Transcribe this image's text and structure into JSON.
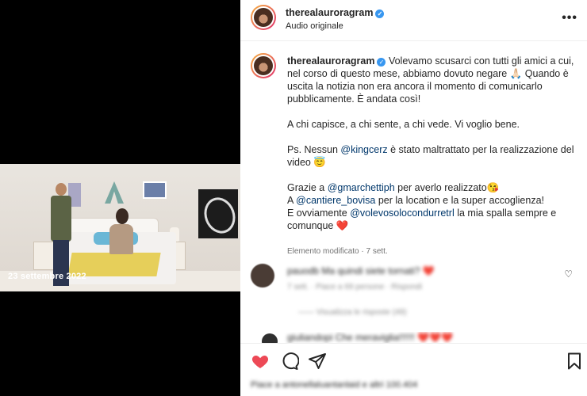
{
  "video": {
    "overlay_caption": "23 settembre 2022"
  },
  "header": {
    "username": "therealauroragram",
    "subtitle": "Audio originale",
    "more_label": "•••"
  },
  "caption": {
    "username": "therealauroragram",
    "para1": "Volevamo scusarci con tutti gli amici a cui, nel corso di questo mese, abbiamo dovuto negare 🙏🏻 Quando è uscita la notizia non era ancora il momento di comunicarlo pubblicamente. È andata così!",
    "para2": "A chi capisce, a chi sente, a chi vede. Vi voglio bene.",
    "para3_prefix": "Ps. Nessun ",
    "para3_mention": "@kingcerz",
    "para3_suffix": " è stato maltrattato per la realizzazione del video 😇",
    "para4_a": "Grazie a ",
    "para4_mention1": "@gmarchettiph",
    "para4_b": " per averlo realizzato😘",
    "para4_c": "A ",
    "para4_mention2": "@cantiere_bovisa",
    "para4_d": " per la location e la super accoglienza!",
    "para4_e": "E ovviamente ",
    "para4_mention3": "@volevosolocondurretrl",
    "para4_f": " la mia spalla sempre e comunque ❤️",
    "meta": "Elemento modificato · 7 sett."
  },
  "comments": [
    {
      "text": "pauodb Ma quindi siete tornati? ❤️",
      "meta": "7 sett. · Piace a 69 persone · Rispondi",
      "replies": "—— Visualizza le risposte (49)"
    },
    {
      "text": "giuliandopi Che meraviglia!!!!!! ❤️❤️❤️"
    }
  ],
  "likes_text": "Piace a antonellaluantanlaid e altri 100.404",
  "icons": {
    "like": "heart-icon",
    "comment": "comment-icon",
    "share": "send-icon",
    "save": "bookmark-icon"
  },
  "colors": {
    "like": "#ed4956",
    "verified": "#3897f0",
    "mention": "#00376b"
  }
}
